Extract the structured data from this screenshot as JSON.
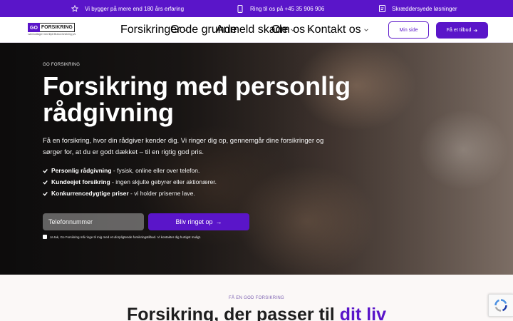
{
  "topbar": {
    "items": [
      {
        "icon": "star-icon",
        "label": "Vi bygger på mere end 180 års erfaring"
      },
      {
        "icon": "phone-icon",
        "label": "Ring til os på +45 35 906 906"
      },
      {
        "icon": "document-icon",
        "label": "Skræddersyede løsninger"
      }
    ]
  },
  "nav": {
    "logo": {
      "go": "GO",
      "word": "FORSIKRING",
      "tagline": "Lønmodtager med tilpå Brand-forsikring p/s"
    },
    "menu": [
      {
        "label": "Forsikringer",
        "dropdown": true
      },
      {
        "label": "Gode grunde",
        "dropdown": false
      },
      {
        "label": "Anmeld skade",
        "dropdown": true
      },
      {
        "label": "Om os",
        "dropdown": true
      },
      {
        "label": "Kontakt os",
        "dropdown": true
      }
    ],
    "min_side": "Min side",
    "tilbud": "Få et tilbud",
    "tilbud_arrow": "➔"
  },
  "hero": {
    "eyebrow": "GO FORSIKRING",
    "title": "Forsikring med personlig rådgivning",
    "description": "Få en forsikring, hvor din rådgiver kender dig. Vi ringer dig op, gennemgår dine forsikringer og sørger for, at du er godt dækket – til en rigtig god pris.",
    "bullets": [
      {
        "bold": "Personlig rådgivning",
        "rest": " - fysisk, online eller over telefon."
      },
      {
        "bold": "Kundeejet forsikring",
        "rest": " - ingen skjulte gebyrer eller aktionærer."
      },
      {
        "bold": "Konkurrencedygtige priser",
        "rest": " - vi holder priserne lave."
      }
    ],
    "phone_placeholder": "Telefonnummer",
    "cta": "Bliv ringet op",
    "cta_arrow": "→",
    "consent": "Ja tak, Go Forsikring må ringe til mig med et uforpligtende forsikringstilbud. Vi kontakter dig hurtigst muligt."
  },
  "section": {
    "eyebrow": "FÅ EN GOD FORSIKRING",
    "title_main": "Forsikring, der passer til ",
    "title_accent": "dit liv"
  },
  "colors": {
    "brand": "#5a15c9",
    "background_light": "#fbf8f7"
  }
}
